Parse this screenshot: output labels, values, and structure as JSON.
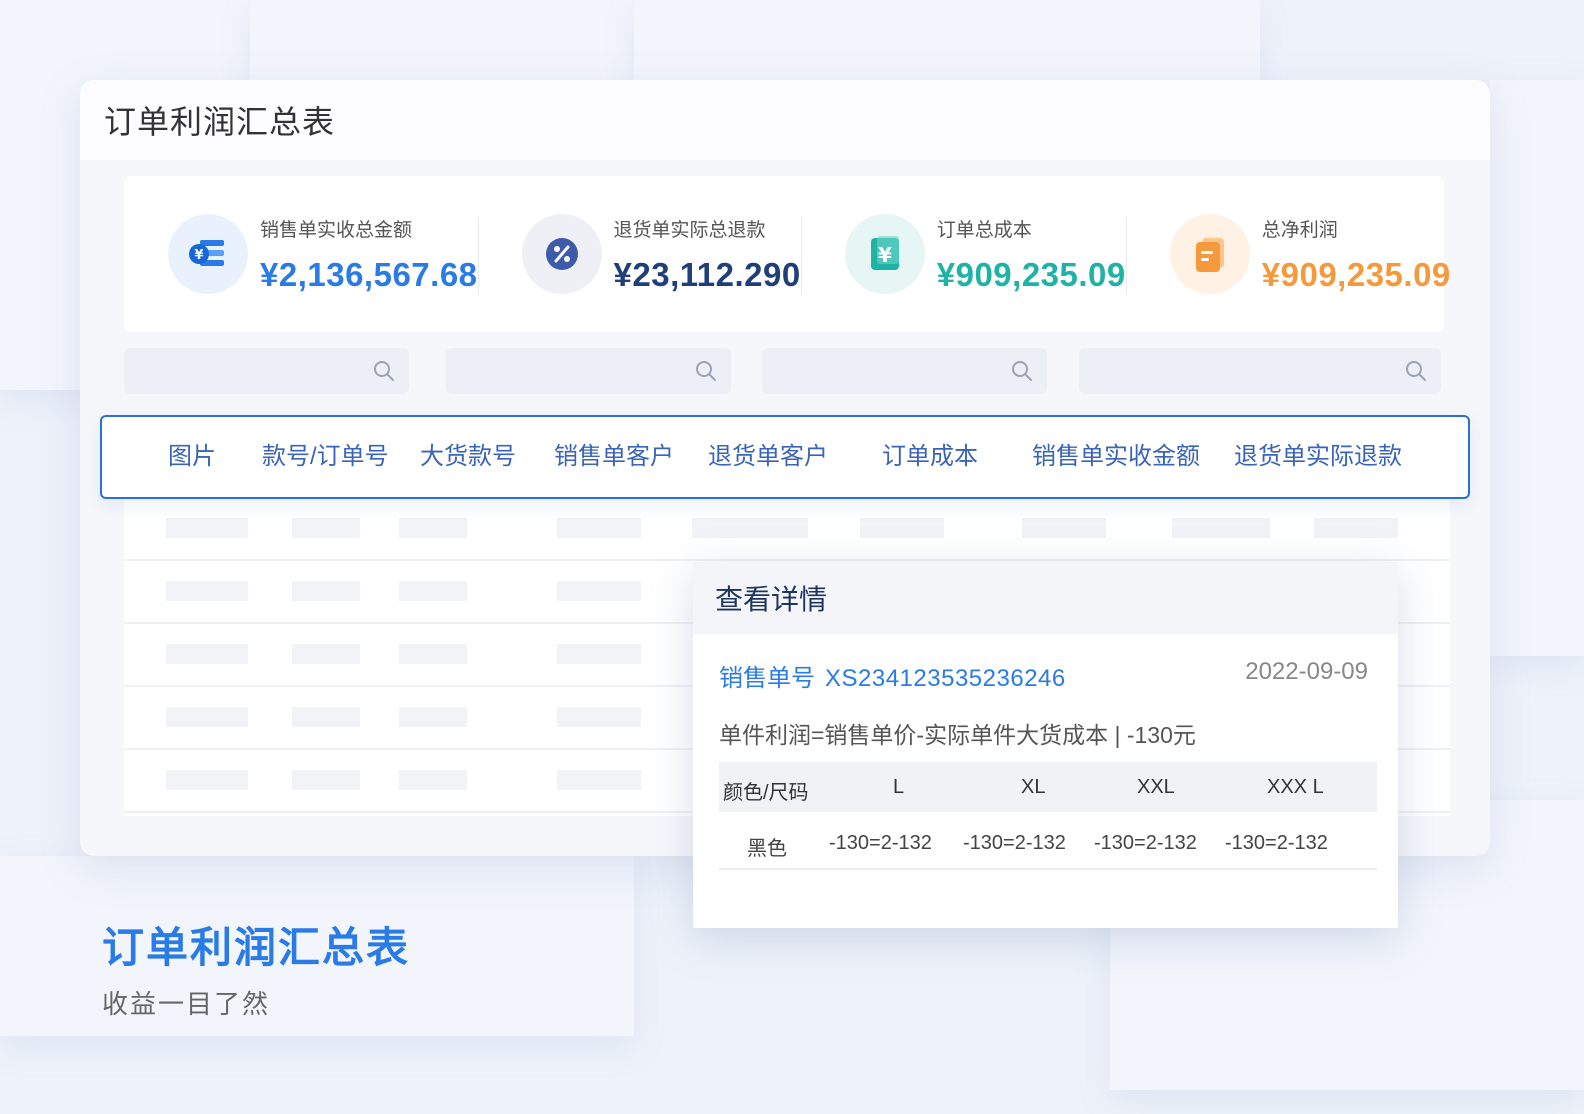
{
  "window": {
    "title": "订单利润汇总表"
  },
  "stats": [
    {
      "label": "销售单实收总金额",
      "value": "¥2,136,567.68",
      "icon": "yen-list-icon",
      "color": "#2a7be6"
    },
    {
      "label": "退货单实际总退款",
      "value": "¥23,112.290",
      "icon": "percent-icon",
      "color": "#1f3f7a"
    },
    {
      "label": "订单总成本",
      "value": "¥909,235.09",
      "icon": "yen-card-icon",
      "color": "#1fb3a5"
    },
    {
      "label": "总净利润",
      "value": "¥909,235.09",
      "icon": "document-icon",
      "color": "#f59a3c"
    }
  ],
  "search": {
    "icon": "search-icon"
  },
  "table": {
    "columns": [
      "图片",
      "款号/订单号",
      "大货款号",
      "销售单客户",
      "退货单客户",
      "订单成本",
      "销售单实收金额",
      "退货单实际退款"
    ]
  },
  "detail": {
    "title": "查看详情",
    "order_label": "销售单号",
    "order_no": "XS234123535236246",
    "date": "2022-09-09",
    "formula": "单件利润=销售单价-实际单件大货成本 | -130元",
    "size_header": [
      "颜色/尺码",
      "L",
      "XL",
      "XXL",
      "XXX L"
    ],
    "rows": [
      {
        "color": "黑色",
        "values": [
          "-130=2-132",
          "-130=2-132",
          "-130=2-132",
          "-130=2-132"
        ]
      }
    ]
  },
  "promo": {
    "title": "订单利润汇总表",
    "subtitle": "收益一目了然"
  },
  "colors": {
    "accent": "#2a7be6",
    "header_border": "#2b6fd8"
  }
}
